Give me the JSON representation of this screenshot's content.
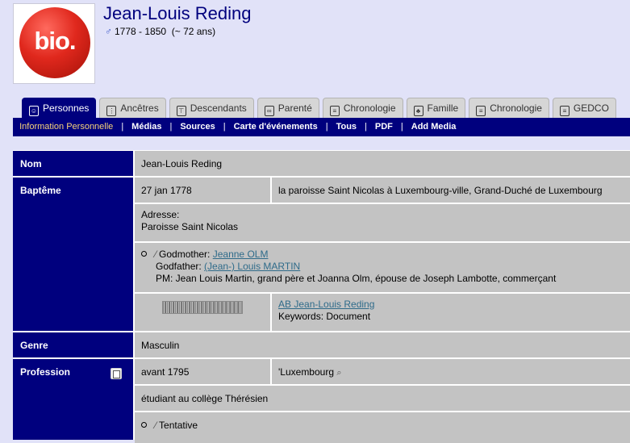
{
  "header": {
    "logo_text": "bio.",
    "name": "Jean-Louis Reding",
    "sex_symbol": "♂",
    "lifespan": "1778 - 1850",
    "age": "(~ 72 ans)"
  },
  "tabs": [
    {
      "label": "Personnes",
      "icon": "person-icon",
      "active": true
    },
    {
      "label": "Ancêtres",
      "icon": "ancestors-icon"
    },
    {
      "label": "Descendants",
      "icon": "descendants-icon"
    },
    {
      "label": "Parenté",
      "icon": "relationship-icon"
    },
    {
      "label": "Chronologie",
      "icon": "timeline-icon"
    },
    {
      "label": "Famille",
      "icon": "family-icon"
    },
    {
      "label": "Chronologie",
      "icon": "timeline-icon"
    },
    {
      "label": "GEDCO",
      "icon": "gedcom-icon"
    }
  ],
  "subnav": {
    "items": [
      "Information Personnelle",
      "Médias",
      "Sources",
      "Carte d'événements",
      "Tous",
      "PDF",
      "Add Media"
    ],
    "separator": "|"
  },
  "facts": {
    "nom": {
      "label": "Nom",
      "value": "Jean-Louis Reding"
    },
    "bapteme": {
      "label": "Baptême",
      "date": "27 jan 1778",
      "place": "la paroisse Saint Nicolas à Luxembourg-ville, Grand-Duché de Luxembourg",
      "address_label": "Adresse:",
      "address_value": "Paroisse Saint Nicolas",
      "godmother_label": "Godmother:",
      "godmother": "Jeanne OLM",
      "godfather_label": "Godfather:",
      "godfather": "(Jean-) Louis MARTIN",
      "pm_note": "PM: Jean Louis Martin, grand père et Joanna Olm, épouse de Joseph Lambotte, commerçant",
      "media_title": "AB Jean-Louis Reding",
      "keywords": "Keywords: Document"
    },
    "genre": {
      "label": "Genre",
      "value": "Masculin"
    },
    "profession": {
      "label": "Profession",
      "date": "avant 1795",
      "place": "'Luxembourg",
      "description": "étudiant au collège Thérésien",
      "note": "Tentative"
    }
  },
  "colors": {
    "background": "#e1e2f8",
    "navy": "#00007e",
    "cell_gray": "#c3c3c3",
    "link": "#2f6b8a",
    "active_subnav": "#f5d27a"
  }
}
